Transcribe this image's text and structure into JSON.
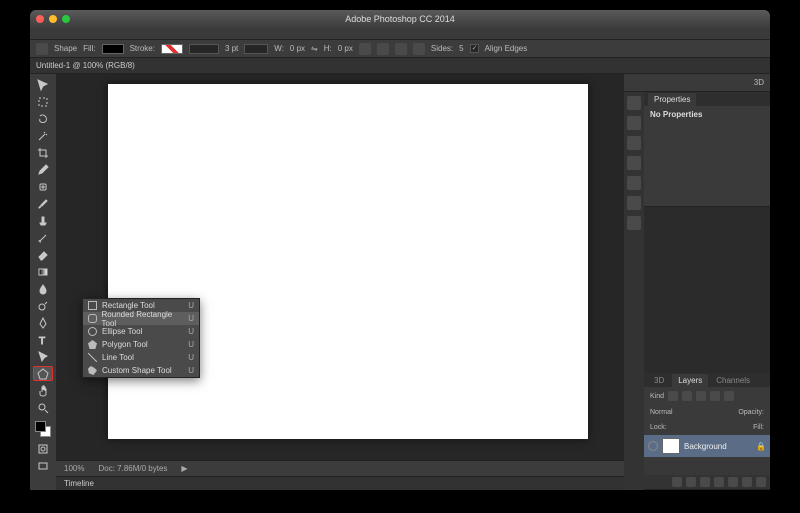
{
  "window": {
    "title": "Adobe Photoshop CC 2014"
  },
  "options": {
    "mode_label": "Shape",
    "fill_label": "Fill:",
    "stroke_label": "Stroke:",
    "stroke_value": "3 pt",
    "w_label": "W:",
    "w_value": "0 px",
    "h_label": "H:",
    "h_value": "0 px",
    "sides_label": "Sides:",
    "sides_value": "5",
    "align_edges_label": "Align Edges"
  },
  "document": {
    "tab_label": "Untitled-1 @ 100% (RGB/8)"
  },
  "tools": {
    "items": [
      "move-tool",
      "rectangular-marquee-tool",
      "lasso-tool",
      "magic-wand-tool",
      "crop-tool",
      "eyedropper-tool",
      "healing-brush-tool",
      "brush-tool",
      "clone-stamp-tool",
      "history-brush-tool",
      "eraser-tool",
      "gradient-tool",
      "blur-tool",
      "dodge-tool",
      "pen-tool",
      "type-tool",
      "path-selection-tool",
      "shape-tool",
      "hand-tool",
      "zoom-tool"
    ],
    "selected": "shape-tool"
  },
  "flyout": {
    "items": [
      {
        "label": "Rectangle Tool",
        "key": "U"
      },
      {
        "label": "Rounded Rectangle Tool",
        "key": "U"
      },
      {
        "label": "Ellipse Tool",
        "key": "U"
      },
      {
        "label": "Polygon Tool",
        "key": "U"
      },
      {
        "label": "Line Tool",
        "key": "U"
      },
      {
        "label": "Custom Shape Tool",
        "key": "U"
      }
    ],
    "selected_index": 1
  },
  "status": {
    "zoom": "100%",
    "doc_info": "Doc: 7.86M/0 bytes"
  },
  "timeline": {
    "label": "Timeline"
  },
  "right": {
    "workspace_tab": "3D",
    "properties": {
      "tab": "Properties",
      "message": "No Properties"
    },
    "layers_panel": {
      "tabs": [
        "3D",
        "Layers",
        "Channels"
      ],
      "active_tab": "Layers",
      "kind_label": "Kind",
      "blend_mode": "Normal",
      "opacity_label": "Opacity:",
      "lock_label": "Lock:",
      "fill_label": "Fill:",
      "layers": [
        {
          "name": "Background",
          "locked": true
        }
      ]
    }
  }
}
